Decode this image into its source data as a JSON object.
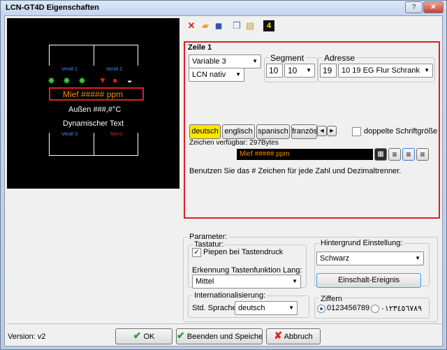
{
  "window": {
    "title": "LCN-GT4D Eigenschaften",
    "help_icon": "help-icon",
    "close_icon": "close-icon",
    "close_glyph": "✕",
    "help_glyph": "?"
  },
  "preview": {
    "button_top_left": "Ventil 1",
    "button_top_right": "Ventil 2",
    "line1": "Mief ##### ppm",
    "line2": "Außen ###,#°C",
    "line3": "Dynamischer Text",
    "button_bottom_left": "Ventil 3",
    "button_bottom_right": "Menü",
    "colors": {
      "accent_blue": "#3d8ff5",
      "accent_red": "#e21d23",
      "line1": "#ff8a00",
      "frame": "#ffffff"
    }
  },
  "toolbar": {
    "icons": [
      "delete-icon",
      "open-folder-icon",
      "save-icon",
      "copy-icon",
      "paste-icon",
      "page-4-icon"
    ],
    "page_label": "4"
  },
  "zeile": {
    "title": "Zeile 1",
    "variable_select": "Variable 3",
    "format_select": "LCN nativ",
    "segment_label": "Segment",
    "segment_value": "10",
    "segment_select": "10",
    "adresse_label": "Adresse",
    "adresse_value": "19",
    "adresse_select": "10  19  EG Flur Schrank",
    "languages": [
      "deutsch",
      "englisch",
      "spanisch",
      "französ"
    ],
    "active_language": "deutsch",
    "double_font_label": "doppelte Schriftgröße",
    "chars_available": "Zeichen verfügbar: 297Bytes",
    "text_value": "Mief ##### ppm",
    "hint": "Benutzen Sie das # Zeichen für jede Zahl und Dezimaltrenner.",
    "border_color": "#e21d23",
    "active_lang_color": "#ffe600"
  },
  "parameter": {
    "title": "Parameter:",
    "tastatur_label": "Tastatur:",
    "piepen_label": "Piepen bei Tastendruck",
    "piepen_checked": "✓",
    "erkennung_label": "Erkennung Tastenfunktion Lang:",
    "erkennung_value": "Mittel",
    "hintergrund_label": "Hintergrund Einstellung:",
    "hintergrund_value": "Schwarz",
    "einschalt_button": "Einschalt-Ereignis",
    "intl_label": "Internationalisierung:",
    "sprache_label": "Std. Sprache",
    "sprache_value": "deutsch",
    "ziffern_label": "Ziffern",
    "ziffern_latin": "0123456789",
    "ziffern_arabic": "٠١٢٣٤٥٦٧٨٩"
  },
  "footer": {
    "version": "Version: v2",
    "ok": "OK",
    "beenden": "Beenden und Speichern",
    "abbruch": "Abbruch"
  }
}
